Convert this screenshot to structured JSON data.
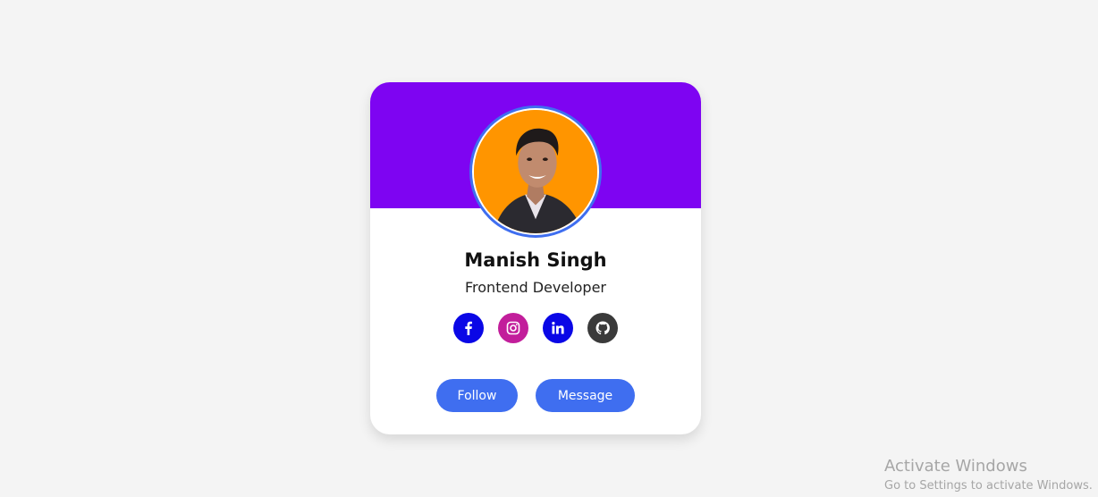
{
  "profile": {
    "name": "Manish Singh",
    "role": "Frontend Developer"
  },
  "socials": [
    {
      "icon": "facebook-icon",
      "color": "#0a07e6"
    },
    {
      "icon": "instagram-icon",
      "color": "#c21e9b"
    },
    {
      "icon": "linkedin-icon",
      "color": "#0a07e6"
    },
    {
      "icon": "github-icon",
      "color": "#3a3a3a"
    }
  ],
  "buttons": {
    "follow_label": "Follow",
    "message_label": "Message"
  },
  "watermark": {
    "title": "Activate Windows",
    "subtitle": "Go to Settings to activate Windows."
  },
  "colors": {
    "banner": "#7e04f2",
    "accent": "#3f6ef0",
    "background": "#f4f4f4"
  }
}
